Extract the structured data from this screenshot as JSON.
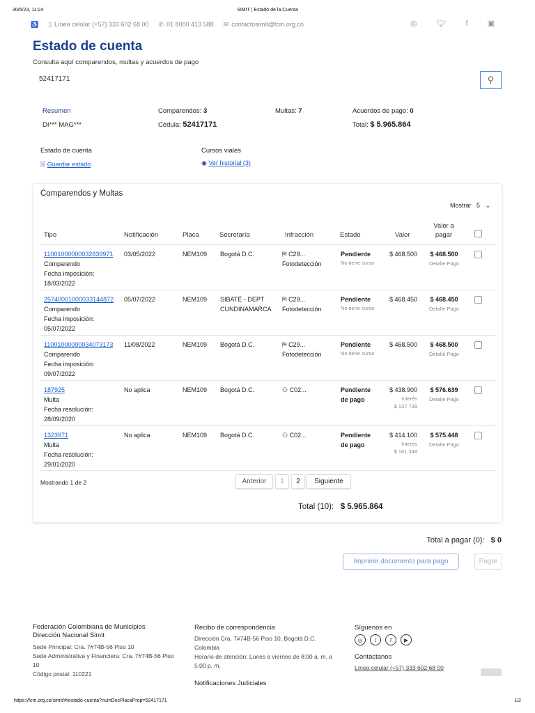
{
  "print_header": {
    "datetime": "30/6/23, 11:24",
    "title": "SIMIT | Estado de la Cuenta"
  },
  "print_footer": {
    "url": "https://fcm.org.co/simit/#/estado-cuenta?numDocPlacaProp=52417171",
    "page": "1/2"
  },
  "topbar": {
    "phone_mobile": "Línea celular (+57) 333 602 68 00",
    "phone": "01 8000 413 588",
    "email": "contactosimit@fcm.org.co",
    "social": [
      "instagram-icon",
      "twitter-icon",
      "facebook-icon",
      "youtube-icon"
    ]
  },
  "header": {
    "title": "Estado de cuenta",
    "subtitle": "Consulta aquí comparendos, multas y acuerdos de pago"
  },
  "search": {
    "value": "52417171"
  },
  "summary": {
    "resumen": "Resumen",
    "name": "DI*** MAG***",
    "comparendos_label": "Comparendos:",
    "comparendos": "3",
    "cedula_label": "Cédula:",
    "cedula": "52417171",
    "multas_label": "Multas:",
    "multas": "7",
    "acuerdos_label": "Acuerdos de pago:",
    "acuerdos": "0",
    "total_label": "Total:",
    "total": "$ 5.965.864"
  },
  "actions": {
    "estado_label": "Estado de cuenta",
    "guardar": "Guardar estado",
    "cursos_label": "Cursos viales",
    "historial": "Ver historial (3)"
  },
  "table": {
    "title": "Comparendos y Multas",
    "mostrar_label": "Mostrar",
    "mostrar_value": "5",
    "headers": {
      "tipo": "Tipo",
      "notificacion": "Notificación",
      "placa": "Placa",
      "secretaria": "Secretaría",
      "infraccion": "Infracción",
      "estado": "Estado",
      "valor": "Valor",
      "valor_pagar": "Valor a pagar"
    },
    "rows": [
      {
        "id": "11001000000032839971",
        "tipo": "Comparendo",
        "fecha_label": "Fecha imposición:",
        "fecha": "18/03/2022",
        "notificacion": "03/05/2022",
        "placa": "NEM109",
        "secretaria": "Bogotá D.C.",
        "infraccion": "C29...",
        "infraccion_sub": "Fotodetección",
        "icon": "camera",
        "estado": "Pendiente",
        "estado_sub": "No tiene curso",
        "valor": "$ 468.500",
        "interes_label": "",
        "interes": "",
        "valor_pagar": "$ 468.500",
        "detalle": "Detalle Pago"
      },
      {
        "id": "25740001000033144872",
        "tipo": "Comparendo",
        "fecha_label": "Fecha imposición:",
        "fecha": "05/07/2022",
        "notificacion": "05/07/2022",
        "placa": "NEM109",
        "secretaria": "SIBATÉ - DEPT CUNDINAMARCA",
        "infraccion": "C29...",
        "infraccion_sub": "Fotodetección",
        "icon": "camera",
        "estado": "Pendiente",
        "estado_sub": "No tiene curso",
        "valor": "$ 468.450",
        "interes_label": "",
        "interes": "",
        "valor_pagar": "$ 468.450",
        "detalle": "Detalle Pago"
      },
      {
        "id": "11001000000034073173",
        "tipo": "Comparendo",
        "fecha_label": "Fecha imposición:",
        "fecha": "09/07/2022",
        "notificacion": "11/08/2022",
        "placa": "NEM109",
        "secretaria": "Bogotá D.C.",
        "infraccion": "C29...",
        "infraccion_sub": "Fotodetección",
        "icon": "camera",
        "estado": "Pendiente",
        "estado_sub": "No tiene curso",
        "valor": "$ 468.500",
        "interes_label": "",
        "interes": "",
        "valor_pagar": "$ 468.500",
        "detalle": "Detalle Pago"
      },
      {
        "id": "187925",
        "tipo": "Multa",
        "fecha_label": "Fecha resolución:",
        "fecha": "28/09/2020",
        "notificacion": "No aplica",
        "placa": "NEM109",
        "secretaria": "Bogotá D.C.",
        "infraccion": "C02...",
        "infraccion_sub": "",
        "icon": "person",
        "estado": "Pendiente de pago",
        "estado_sub": "",
        "valor": "$ 438.900",
        "interes_label": "Interés",
        "interes": "$ 137.739",
        "valor_pagar": "$ 576.639",
        "detalle": "Detalle Pago"
      },
      {
        "id": "1323971",
        "tipo": "Multa",
        "fecha_label": "Fecha resolución:",
        "fecha": "29/01/2020",
        "notificacion": "No aplica",
        "placa": "NEM109",
        "secretaria": "Bogotá D.C.",
        "infraccion": "C02...",
        "infraccion_sub": "",
        "icon": "person",
        "estado": "Pendiente de pago",
        "estado_sub": "",
        "valor": "$ 414.100",
        "interes_label": "Interés",
        "interes": "$ 161.348",
        "valor_pagar": "$ 575.448",
        "detalle": "Detalle Pago"
      }
    ],
    "showing": "Mostrando 1 de 2",
    "pagination": {
      "prev": "Anterior",
      "p1": "1",
      "p2": "2",
      "next": "Siguiente"
    },
    "total_label": "Total (10):",
    "total": "$ 5.965.864"
  },
  "payment": {
    "total_label": "Total a pagar (0):",
    "total": "$ 0",
    "print_btn": "Imprimir documento para pago",
    "pay_btn": "Pagar"
  },
  "footer": {
    "org1": "Federación Colombiana de Municipios",
    "org2": "Dirección Nacional Simit",
    "sede": "Sede Principal: Cra. 7#74B-56 Piso 10",
    "sede_admin": "Sede Administrativa y Financiera: Cra. 7#74B-56 Piso 10",
    "postal": "Código postal: 110221",
    "recibo_title": "Recibo de correspondencia",
    "direccion": "Dirección Cra. 7#74B-56 Piso 10, Bogotá D.C. Colombia",
    "horario": "Horario de atención: Lunes a viernes de 8:00 a. m. a 5:00 p. m.",
    "notificaciones": "Notificaciones Judiciales",
    "siguenos": "Síguenos en",
    "contactanos": "Contáctanos",
    "linea": "Línea celular (+57) 333 602 68 00"
  },
  "colors": {
    "primary": "#1d3f8f",
    "link": "#1a5fd0",
    "button_border": "#9bbbe8"
  }
}
